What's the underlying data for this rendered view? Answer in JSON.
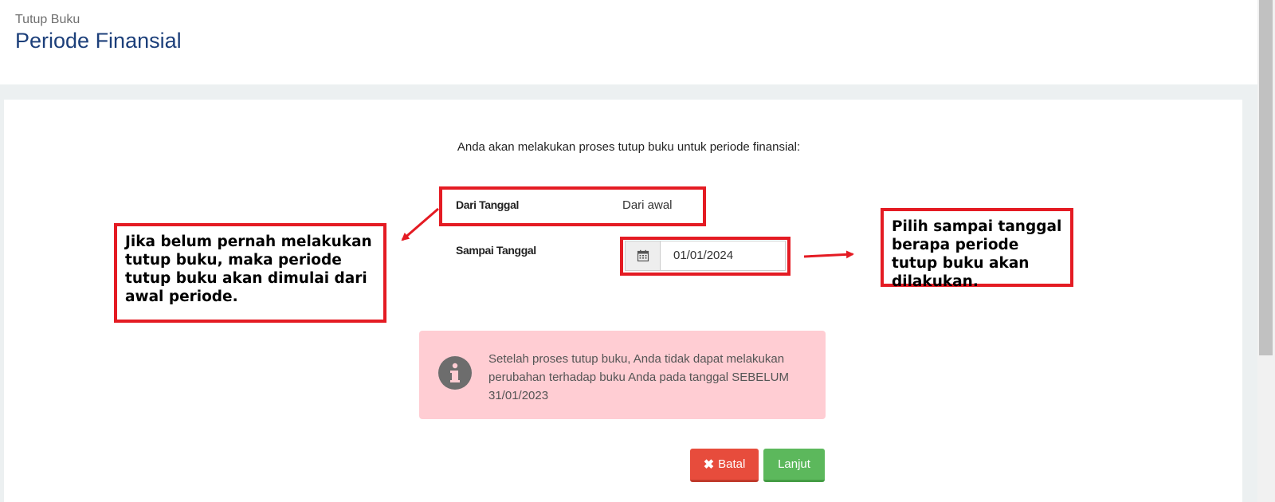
{
  "header": {
    "breadcrumb": "Tutup Buku",
    "title": "Periode Finansial"
  },
  "form": {
    "intro": "Anda akan melakukan proses tutup buku untuk periode finansial:",
    "from_label": "Dari Tanggal",
    "from_value": "Dari awal",
    "to_label": "Sampai Tanggal",
    "to_value": "01/01/2024",
    "to_icon": "calendar-icon"
  },
  "alert": {
    "icon": "info-circle-icon",
    "text": "Setelah proses tutup buku, Anda tidak dapat melakukan perubahan terhadap buku Anda pada tanggal SEBELUM 31/01/2023"
  },
  "buttons": {
    "cancel": "Batal",
    "cancel_icon": "close-icon",
    "next": "Lanjut"
  },
  "annotations": {
    "left_note": "Jika belum pernah melakukan tutup buku, maka periode tutup buku akan dimulai dari awal periode.",
    "right_note": "Pilih sampai tanggal berapa periode tutup buku akan dilakukan."
  },
  "colors": {
    "title": "#1c3f7a",
    "callout_red": "#e41b23",
    "alert_bg": "#ffcdd3",
    "cancel_bg": "#e74c3c",
    "next_bg": "#5cb85c"
  }
}
